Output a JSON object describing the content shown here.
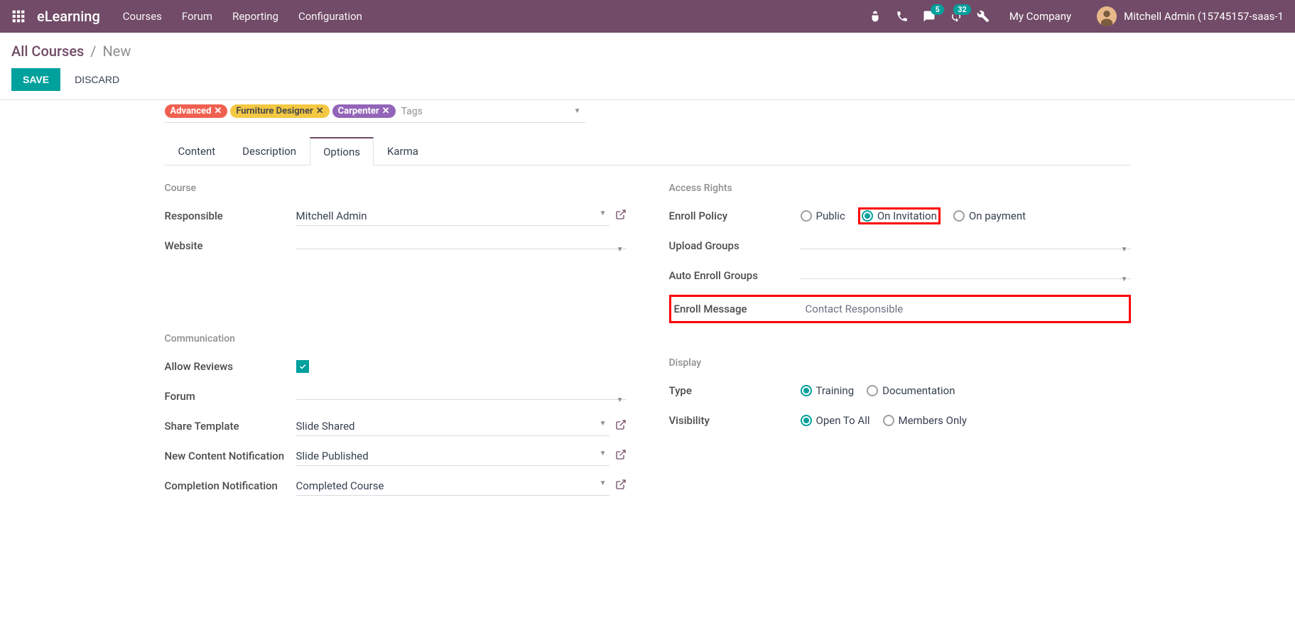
{
  "nav": {
    "app_name": "eLearning",
    "items": [
      "Courses",
      "Forum",
      "Reporting",
      "Configuration"
    ],
    "messages_badge": "5",
    "activities_badge": "32",
    "company": "My Company",
    "user": "Mitchell Admin (15745157-saas-1"
  },
  "breadcrumb": {
    "link": "All Courses",
    "current": "New"
  },
  "buttons": {
    "save": "SAVE",
    "discard": "DISCARD"
  },
  "tags": {
    "items": [
      {
        "label": "Advanced",
        "color": "red"
      },
      {
        "label": "Furniture Designer",
        "color": "yellow"
      },
      {
        "label": "Carpenter",
        "color": "purple"
      }
    ],
    "placeholder": "Tags"
  },
  "tabs": {
    "items": [
      "Content",
      "Description",
      "Options",
      "Karma"
    ],
    "active": "Options"
  },
  "course": {
    "title": "Course",
    "responsible_label": "Responsible",
    "responsible_value": "Mitchell Admin",
    "website_label": "Website",
    "website_value": ""
  },
  "access": {
    "title": "Access Rights",
    "enroll_policy_label": "Enroll Policy",
    "enroll_options": [
      "Public",
      "On Invitation",
      "On payment"
    ],
    "enroll_selected": "On Invitation",
    "upload_groups_label": "Upload Groups",
    "auto_enroll_label": "Auto Enroll Groups",
    "enroll_message_label": "Enroll Message",
    "enroll_message_value": "Contact Responsible"
  },
  "communication": {
    "title": "Communication",
    "allow_reviews_label": "Allow Reviews",
    "allow_reviews_checked": true,
    "forum_label": "Forum",
    "share_template_label": "Share Template",
    "share_template_value": "Slide Shared",
    "new_content_label": "New Content Notification",
    "new_content_value": "Slide Published",
    "completion_label": "Completion Notification",
    "completion_value": "Completed Course"
  },
  "display": {
    "title": "Display",
    "type_label": "Type",
    "type_options": [
      "Training",
      "Documentation"
    ],
    "type_selected": "Training",
    "visibility_label": "Visibility",
    "visibility_options": [
      "Open To All",
      "Members Only"
    ],
    "visibility_selected": "Open To All"
  }
}
